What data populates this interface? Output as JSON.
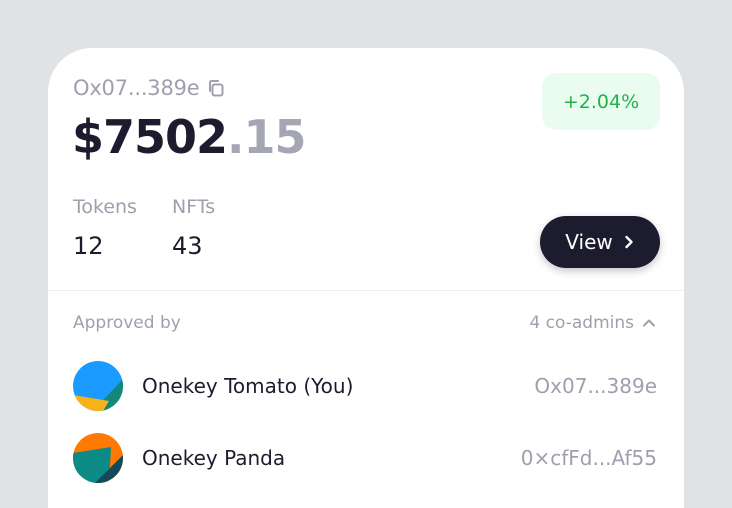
{
  "wallet": {
    "address": "Ox07...389e",
    "balance_whole": "$7502",
    "balance_decimal": ".15",
    "change": "+2.04%"
  },
  "stats": [
    {
      "label": "Tokens",
      "value": "12"
    },
    {
      "label": "NFTs",
      "value": "43"
    }
  ],
  "view_button": {
    "label": "View"
  },
  "approvals": {
    "label": "Approved by",
    "coadmins": "4 co-admins",
    "admins": [
      {
        "name": "Onekey Tomato (You)",
        "address": "Ox07...389e"
      },
      {
        "name": "Onekey Panda",
        "address": "0×cfFd...Af55"
      }
    ]
  },
  "icons": {
    "copy": "copy-icon",
    "view_chevron": "chevron-right-icon",
    "coadmins_chevron": "chevron-up-icon"
  },
  "colors": {
    "background": "#dfe3e6",
    "card": "#ffffff",
    "text_primary": "#1c1c2e",
    "text_muted": "#9ea0ad",
    "positive": "#22b24c",
    "positive_bg": "#eafbf0",
    "button_dark": "#1c1c2e"
  }
}
